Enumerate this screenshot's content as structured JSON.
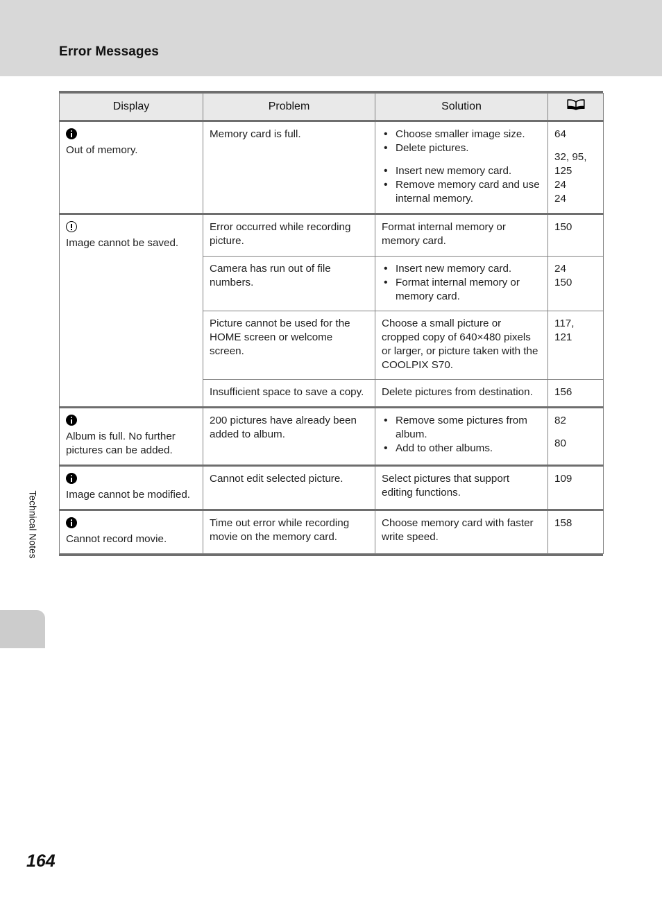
{
  "page": {
    "section_title": "Error Messages",
    "side_tab_label": "Technical Notes",
    "page_number": "164"
  },
  "table": {
    "columns": [
      {
        "key": "display",
        "label": "Display"
      },
      {
        "key": "problem",
        "label": "Problem"
      },
      {
        "key": "solution",
        "label": "Solution"
      },
      {
        "key": "page_ref",
        "label": "",
        "icon": "open-book-icon"
      }
    ],
    "groups": [
      {
        "display": {
          "icon": "info-filled-icon",
          "text": "Out of memory."
        },
        "rows": [
          {
            "problem": "Memory card is full.",
            "solution_bullets": [
              {
                "text": "Choose smaller image size.",
                "gap": false
              },
              {
                "text": "Delete pictures.",
                "gap": false
              },
              {
                "text": "Insert new memory card.",
                "gap": true
              },
              {
                "text": "Remove memory card and use internal memory.",
                "gap": false
              }
            ],
            "page_refs": [
              {
                "text": "64",
                "gap": false
              },
              {
                "text": "32, 95,",
                "gap": true
              },
              {
                "text": "125",
                "gap": false
              },
              {
                "text": "24",
                "gap": false
              },
              {
                "text": "24",
                "gap": false
              }
            ]
          }
        ]
      },
      {
        "display": {
          "icon": "warning-outline-icon",
          "text": "Image cannot be saved."
        },
        "rows": [
          {
            "problem": "Error occurred while recording picture.",
            "solution_text": "Format internal memory or memory card.",
            "page_refs": [
              {
                "text": "150",
                "gap": false
              }
            ]
          },
          {
            "problem": "Camera has run out of file numbers.",
            "solution_bullets": [
              {
                "text": "Insert new memory card.",
                "gap": false
              },
              {
                "text": "Format internal memory or memory card.",
                "gap": false
              }
            ],
            "page_refs": [
              {
                "text": "24",
                "gap": false
              },
              {
                "text": "150",
                "gap": false
              }
            ]
          },
          {
            "problem": "Picture cannot be used for the HOME screen or welcome screen.",
            "solution_text": "Choose a small picture or cropped copy of 640×480 pixels or larger, or picture taken with the COOLPIX S70.",
            "page_refs": [
              {
                "text": "117,",
                "gap": false
              },
              {
                "text": "121",
                "gap": false
              }
            ]
          },
          {
            "problem": "Insufficient space to save a copy.",
            "solution_text": "Delete pictures from destination.",
            "page_refs": [
              {
                "text": "156",
                "gap": false
              }
            ]
          }
        ]
      },
      {
        "display": {
          "icon": "info-filled-icon",
          "text": "Album is full. No further pictures can be added."
        },
        "rows": [
          {
            "problem": "200 pictures have already been added to album.",
            "solution_bullets": [
              {
                "text": "Remove some pictures from album.",
                "gap": false
              },
              {
                "text": "Add to other albums.",
                "gap": false
              }
            ],
            "page_refs": [
              {
                "text": "82",
                "gap": false
              },
              {
                "text": "80",
                "gap": true
              }
            ]
          }
        ]
      },
      {
        "display": {
          "icon": "info-filled-icon",
          "text": "Image cannot be modified."
        },
        "rows": [
          {
            "problem": "Cannot edit selected picture.",
            "solution_text": "Select pictures that support editing functions.",
            "page_refs": [
              {
                "text": "109",
                "gap": false
              }
            ]
          }
        ]
      },
      {
        "display": {
          "icon": "info-filled-icon",
          "text": "Cannot record movie."
        },
        "rows": [
          {
            "problem": "Time out error while recording movie on the memory card.",
            "solution_text": "Choose memory card with faster write speed.",
            "page_refs": [
              {
                "text": "158",
                "gap": false
              }
            ]
          }
        ]
      }
    ]
  }
}
